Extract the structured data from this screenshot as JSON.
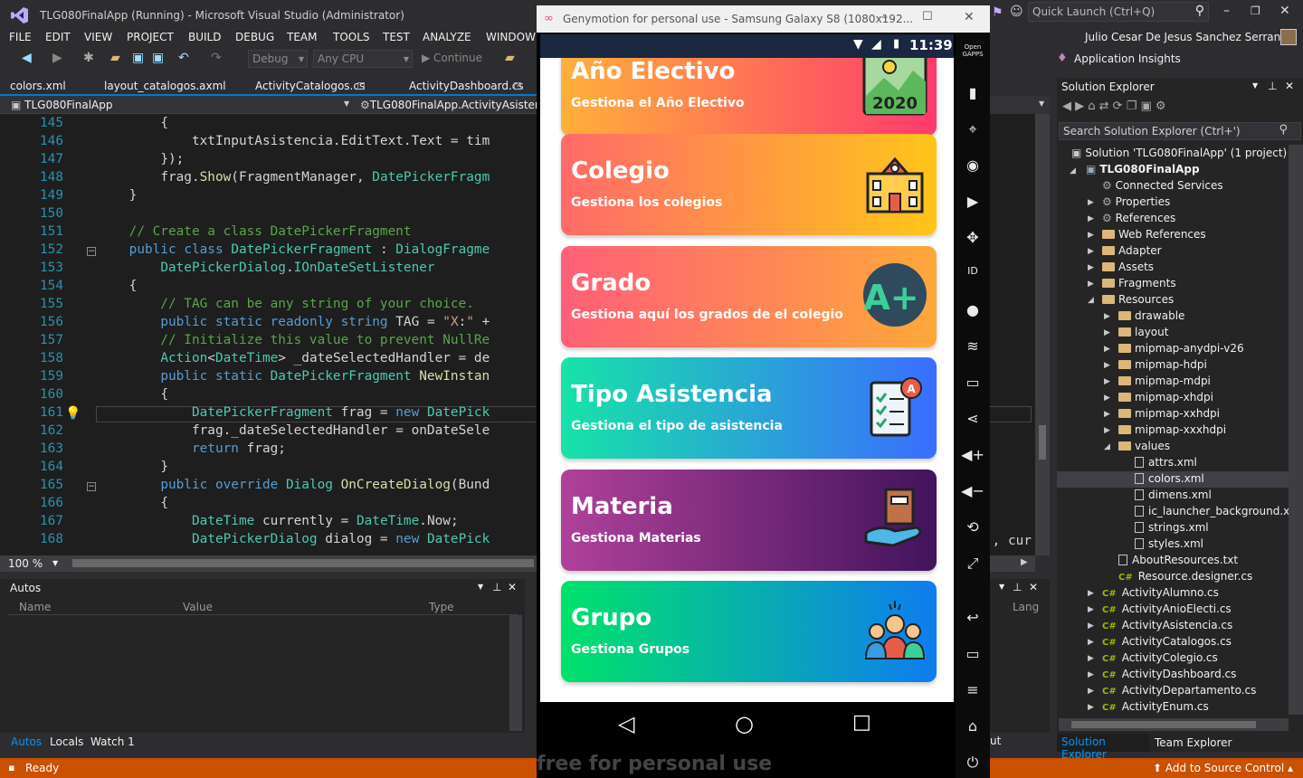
{
  "vs": {
    "window_title": "TLG080FinalApp (Running) - Microsoft Visual Studio  (Administrator)",
    "quick_launch_placeholder": "Quick Launch (Ctrl+Q)",
    "user_name": "Julio Cesar De Jesus Sanchez Serrano",
    "insights": "Application Insights",
    "menu": [
      "FILE",
      "EDIT",
      "VIEW",
      "PROJECT",
      "BUILD",
      "DEBUG",
      "TEAM",
      "TOOLS",
      "TEST",
      "ANALYZE",
      "WINDOW"
    ],
    "toolbar": {
      "config": "Debug",
      "platform": "Any CPU",
      "continue": "Continue"
    },
    "doc_tabs": [
      "colors.xml",
      "layout_catalogos.axml",
      "ActivityCatalogos.cs",
      "ActivityDashboard.cs"
    ],
    "nav_project": "TLG080FinalApp",
    "nav_class": "TLG080FinalApp.ActivityAsistencia",
    "zoom": "100 %",
    "status": "Ready",
    "source_control": "Add to Source Control",
    "right_edge_code": "), cur"
  },
  "code": {
    "lines": [
      {
        "n": "145",
        "t": "        {"
      },
      {
        "n": "146",
        "t": "            txtInputAsistencia.EditText.Text = tim"
      },
      {
        "n": "147",
        "t": "        });"
      },
      {
        "n": "148",
        "t": "        frag.Show(FragmentManager, DatePickerFragm"
      },
      {
        "n": "149",
        "t": "    }"
      },
      {
        "n": "150",
        "t": ""
      },
      {
        "n": "151",
        "t": "    // Create a class DatePickerFragment"
      },
      {
        "n": "152",
        "t": "    public class DatePickerFragment : DialogFragme"
      },
      {
        "n": "153",
        "t": "        DatePickerDialog.IOnDateSetListener"
      },
      {
        "n": "154",
        "t": "    {"
      },
      {
        "n": "155",
        "t": "        // TAG can be any string of your choice."
      },
      {
        "n": "156",
        "t": "        public static readonly string TAG = \"X:\" +"
      },
      {
        "n": "157",
        "t": "        // Initialize this value to prevent NullRe"
      },
      {
        "n": "158",
        "t": "        Action<DateTime> _dateSelectedHandler = de"
      },
      {
        "n": "159",
        "t": "        public static DatePickerFragment NewInstan"
      },
      {
        "n": "160",
        "t": "        {"
      },
      {
        "n": "161",
        "t": "            DatePickerFragment frag = new DatePick"
      },
      {
        "n": "162",
        "t": "            frag._dateSelectedHandler = onDateSele"
      },
      {
        "n": "163",
        "t": "            return frag;"
      },
      {
        "n": "164",
        "t": "        }"
      },
      {
        "n": "165",
        "t": "        public override Dialog OnCreateDialog(Bund"
      },
      {
        "n": "166",
        "t": "        {"
      },
      {
        "n": "167",
        "t": "            DateTime currently = DateTime.Now;"
      },
      {
        "n": "168",
        "t": "            DatePickerDialog dialog = new DatePick"
      }
    ]
  },
  "autos": {
    "title": "Autos",
    "cols": [
      "Name",
      "Value",
      "Type"
    ],
    "lang": "Lang",
    "tabs": [
      "Autos",
      "Locals",
      "Watch 1"
    ]
  },
  "solution_explorer": {
    "title": "Solution Explorer",
    "search_placeholder": "Search Solution Explorer (Ctrl+')",
    "solution": "Solution 'TLG080FinalApp' (1 project)",
    "project": "TLG080FinalApp",
    "items": [
      {
        "label": "Connected Services",
        "indent": 1,
        "kind": "svc",
        "exp": ""
      },
      {
        "label": "Properties",
        "indent": 1,
        "kind": "prop",
        "exp": "▶"
      },
      {
        "label": "References",
        "indent": 1,
        "kind": "ref",
        "exp": "▶"
      },
      {
        "label": "Web References",
        "indent": 1,
        "kind": "folder",
        "exp": "▶"
      },
      {
        "label": "Adapter",
        "indent": 1,
        "kind": "folder",
        "exp": "▶"
      },
      {
        "label": "Assets",
        "indent": 1,
        "kind": "folder",
        "exp": "▶"
      },
      {
        "label": "Fragments",
        "indent": 1,
        "kind": "folder",
        "exp": "▶"
      },
      {
        "label": "Resources",
        "indent": 1,
        "kind": "folder",
        "exp": "◢"
      },
      {
        "label": "drawable",
        "indent": 2,
        "kind": "folder",
        "exp": "▶"
      },
      {
        "label": "layout",
        "indent": 2,
        "kind": "folder",
        "exp": "▶"
      },
      {
        "label": "mipmap-anydpi-v26",
        "indent": 2,
        "kind": "folder",
        "exp": "▶"
      },
      {
        "label": "mipmap-hdpi",
        "indent": 2,
        "kind": "folder",
        "exp": "▶"
      },
      {
        "label": "mipmap-mdpi",
        "indent": 2,
        "kind": "folder",
        "exp": "▶"
      },
      {
        "label": "mipmap-xhdpi",
        "indent": 2,
        "kind": "folder",
        "exp": "▶"
      },
      {
        "label": "mipmap-xxhdpi",
        "indent": 2,
        "kind": "folder",
        "exp": "▶"
      },
      {
        "label": "mipmap-xxxhdpi",
        "indent": 2,
        "kind": "folder",
        "exp": "▶"
      },
      {
        "label": "values",
        "indent": 2,
        "kind": "folder",
        "exp": "◢"
      },
      {
        "label": "attrs.xml",
        "indent": 3,
        "kind": "file",
        "exp": ""
      },
      {
        "label": "colors.xml",
        "indent": 3,
        "kind": "file",
        "exp": "",
        "selected": true
      },
      {
        "label": "dimens.xml",
        "indent": 3,
        "kind": "file",
        "exp": ""
      },
      {
        "label": "ic_launcher_background.xr",
        "indent": 3,
        "kind": "file",
        "exp": ""
      },
      {
        "label": "strings.xml",
        "indent": 3,
        "kind": "file",
        "exp": ""
      },
      {
        "label": "styles.xml",
        "indent": 3,
        "kind": "file",
        "exp": ""
      },
      {
        "label": "AboutResources.txt",
        "indent": 2,
        "kind": "file",
        "exp": ""
      },
      {
        "label": "Resource.designer.cs",
        "indent": 2,
        "kind": "cs",
        "exp": ""
      },
      {
        "label": "ActivityAlumno.cs",
        "indent": 1,
        "kind": "cs",
        "exp": "▶"
      },
      {
        "label": "ActivityAnioElecti.cs",
        "indent": 1,
        "kind": "cs",
        "exp": "▶"
      },
      {
        "label": "ActivityAsistencia.cs",
        "indent": 1,
        "kind": "cs",
        "exp": "▶"
      },
      {
        "label": "ActivityCatalogos.cs",
        "indent": 1,
        "kind": "cs",
        "exp": "▶"
      },
      {
        "label": "ActivityColegio.cs",
        "indent": 1,
        "kind": "cs",
        "exp": "▶"
      },
      {
        "label": "ActivityDashboard.cs",
        "indent": 1,
        "kind": "cs",
        "exp": "▶"
      },
      {
        "label": "ActivityDepartamento.cs",
        "indent": 1,
        "kind": "cs",
        "exp": "▶"
      },
      {
        "label": "ActivityEnum.cs",
        "indent": 1,
        "kind": "cs",
        "exp": "▶"
      }
    ],
    "tabs": [
      "Solution Explorer",
      "Team Explorer"
    ]
  },
  "genymotion": {
    "title": "Genymotion for personal use - Samsung Galaxy S8 (1080x192...",
    "time": "11:39",
    "watermark": "free for personal use",
    "side_buttons": [
      "Open GAPPS",
      "battery-icon",
      "gps-icon",
      "camera-icon",
      "capture-icon",
      "move-icon",
      "id-icon",
      "disk-icon",
      "rss-icon",
      "sms-icon",
      "share-icon",
      "volume-up-icon",
      "volume-down-icon",
      "rotate-icon",
      "scale-icon",
      "back-icon",
      "recent-icon",
      "menu-icon",
      "home-icon",
      "power-icon"
    ]
  },
  "cards": [
    {
      "title": "Año Electivo",
      "subtitle": "Gestiona el Año Electivo",
      "icon": "calendar-2020-icon",
      "from": "#ffb03a",
      "to": "#ff3a6e",
      "badge": "2020"
    },
    {
      "title": "Colegio",
      "subtitle": "Gestiona los colegios",
      "icon": "school-building-icon",
      "from": "#ff6a6a",
      "to": "#ffc61a"
    },
    {
      "title": "Grado",
      "subtitle": "Gestiona aquí los grados de el colegio",
      "icon": "grade-a-plus-icon",
      "from": "#ff5f78",
      "to": "#ffa83a",
      "badge": "A+"
    },
    {
      "title": "Tipo Asistencia",
      "subtitle": "Gestiona el tipo de asistencia",
      "icon": "attendance-checklist-icon",
      "from": "#17e3a8",
      "to": "#3a6dff"
    },
    {
      "title": "Materia",
      "subtitle": "Gestiona Materias",
      "icon": "book-in-hand-icon",
      "from": "#b0419a",
      "to": "#42135c"
    },
    {
      "title": "Grupo",
      "subtitle": "Gestiona Grupos",
      "icon": "group-of-people-icon",
      "from": "#00e36a",
      "to": "#0f7cf0"
    }
  ]
}
